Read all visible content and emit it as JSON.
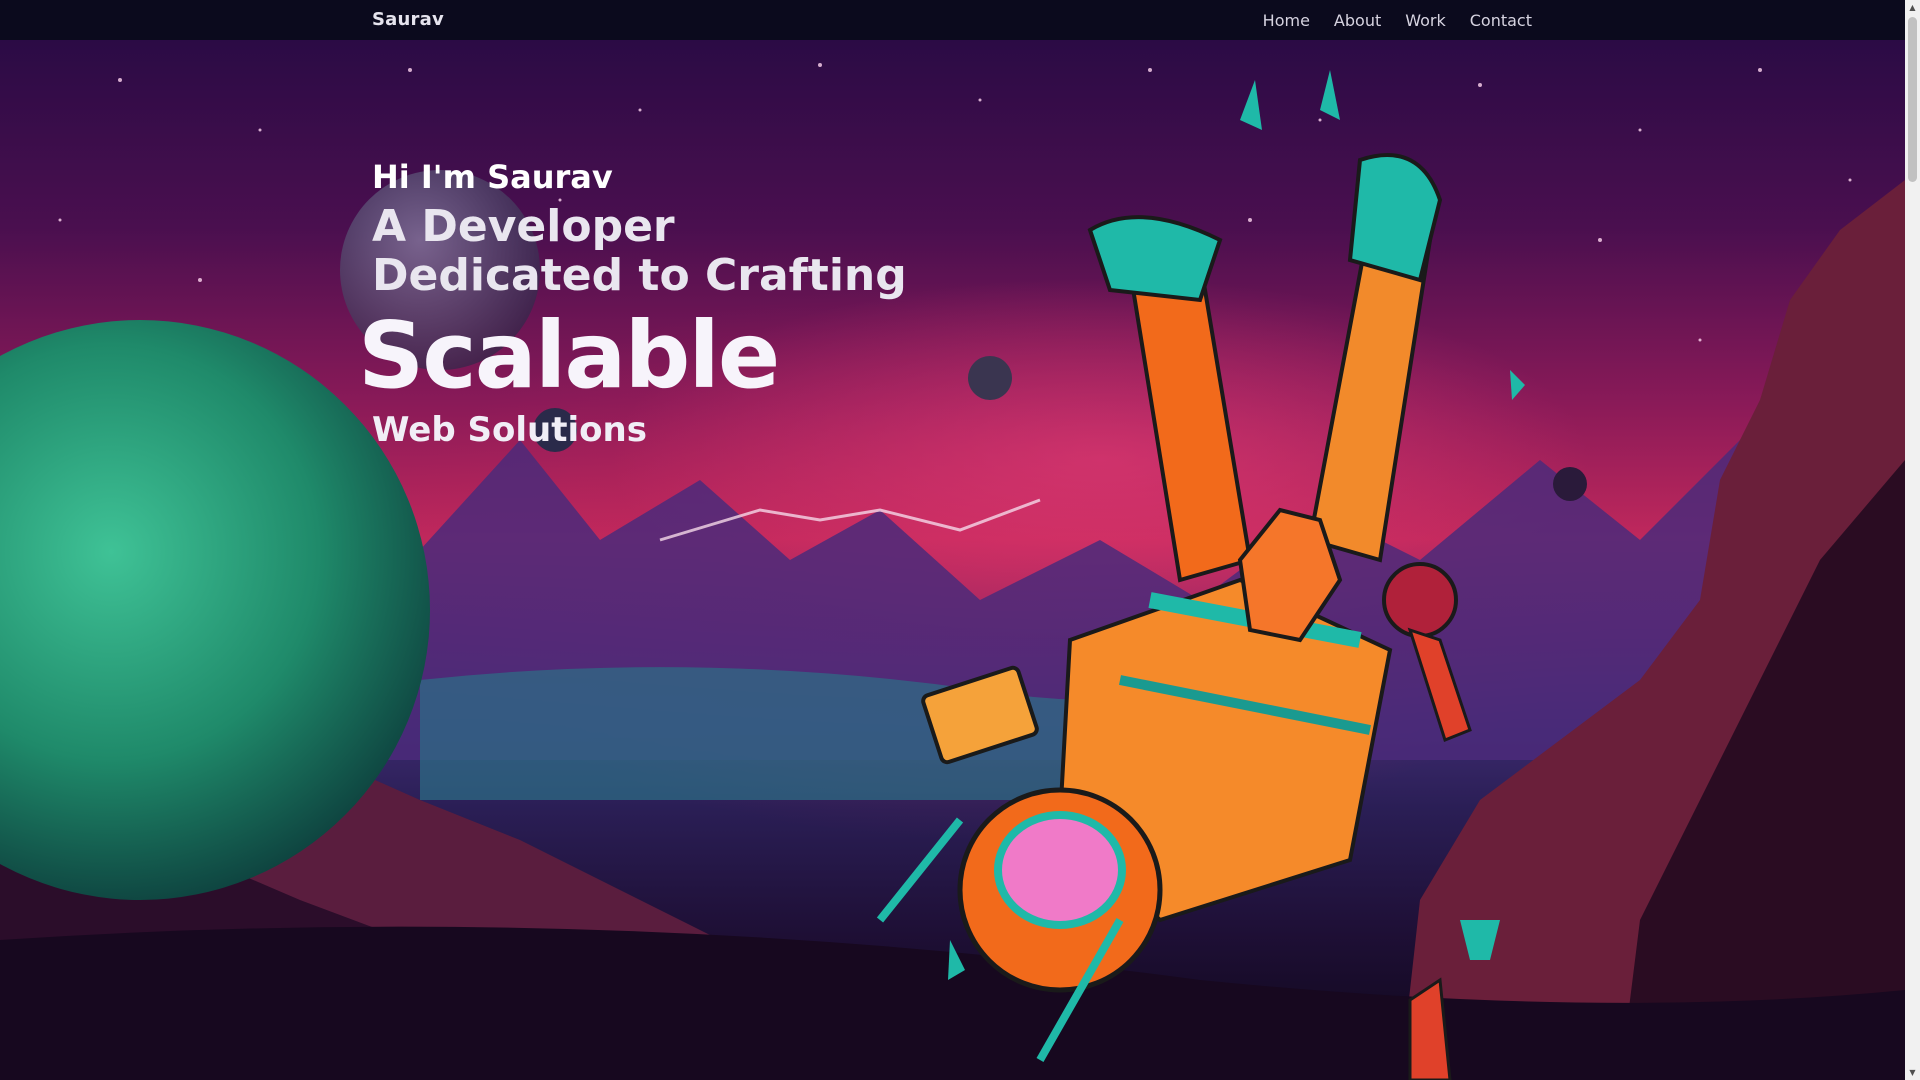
{
  "nav": {
    "brand": "Saurav",
    "links": [
      "Home",
      "About",
      "Work",
      "Contact"
    ]
  },
  "hero": {
    "greeting": "Hi I'm Saurav",
    "line1": "A Developer",
    "line2": "Dedicated to Crafting",
    "highlight": "Scalable",
    "line3": "Web Solutions"
  },
  "scene": {
    "description_icons": [
      "planet-icon",
      "astronaut-illustration",
      "moon-icon"
    ]
  },
  "scrollbar": {
    "up_glyph": "▲",
    "down_glyph": "▼"
  },
  "colors": {
    "nav_bg": "#0b0a1d",
    "sky_top": "#2b0b45",
    "sky_glow": "#c0285c",
    "planet": "#1f8a6a",
    "astronaut_orange": "#f26a1b",
    "astronaut_teal": "#1fb9a8"
  }
}
